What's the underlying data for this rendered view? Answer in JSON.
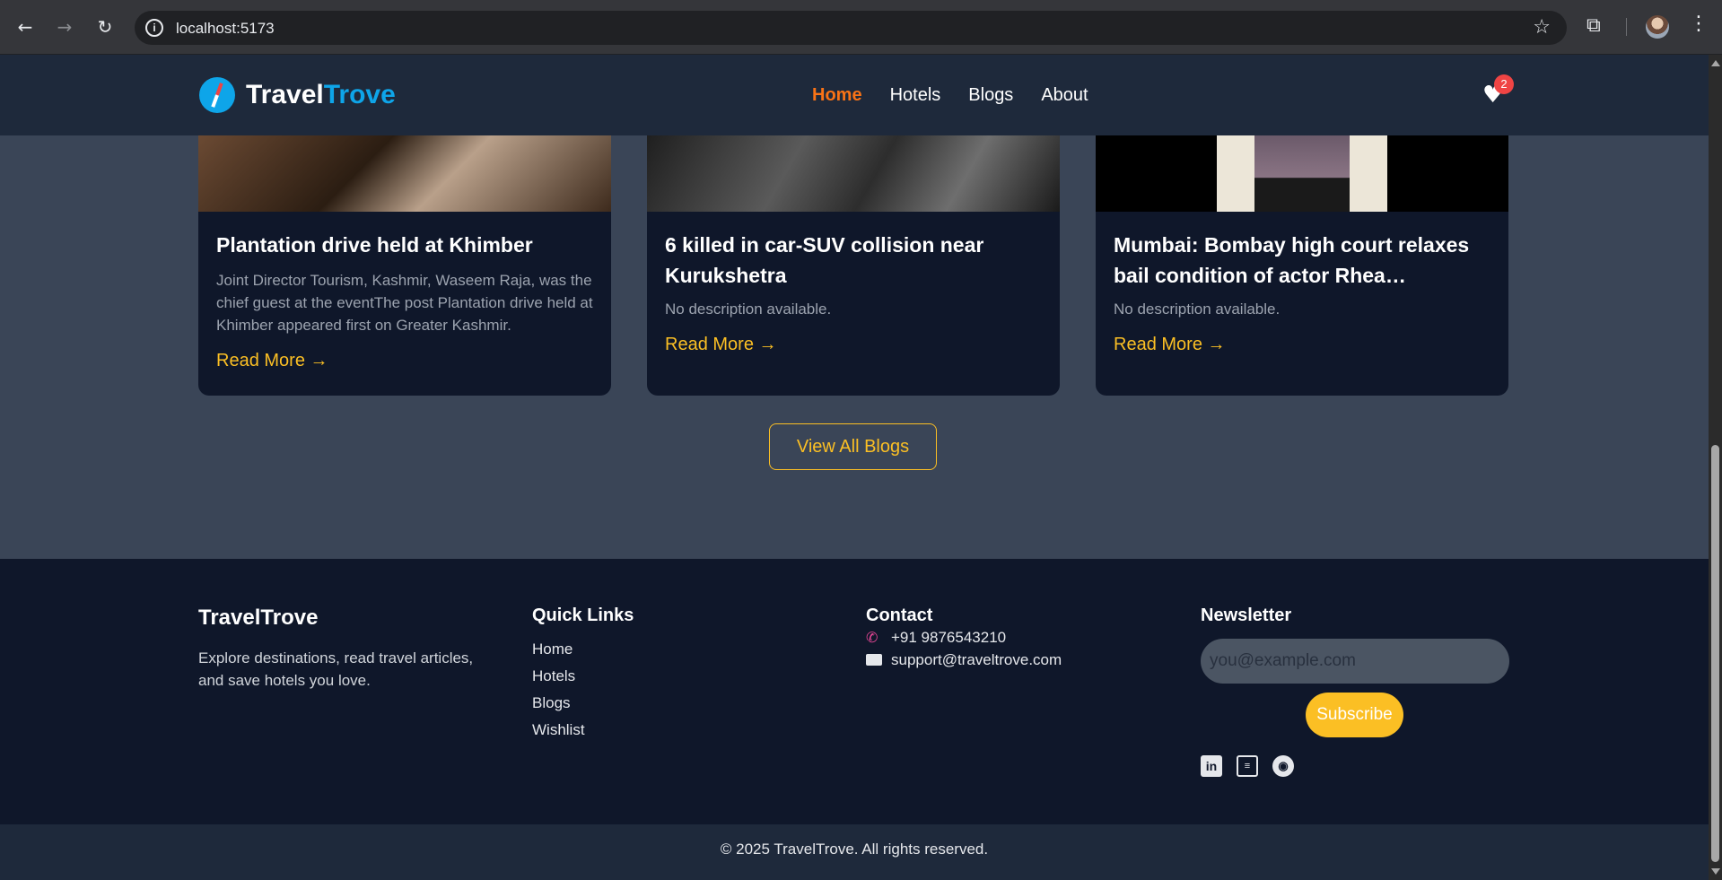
{
  "browser": {
    "url": "localhost:5173"
  },
  "header": {
    "logo_part1": "Travel",
    "logo_part2": "Trove",
    "nav": [
      "Home",
      "Hotels",
      "Blogs",
      "About"
    ],
    "active_nav": "Home",
    "wishlist_count": "2"
  },
  "blogs": [
    {
      "title": "Plantation drive held at Khimber",
      "description": "Joint Director Tourism, Kashmir, Waseem Raja, was the chief guest at the eventThe post Plantation drive held at Khimber appeared first on Greater Kashmir.",
      "link": "Read More →"
    },
    {
      "title": "6 killed in car-SUV collision near Kurukshetra",
      "description": "No description available.",
      "link": "Read More →"
    },
    {
      "title": "Mumbai: Bombay high court relaxes bail condition of actor Rhea…",
      "description": "No description available.",
      "link": "Read More →"
    }
  ],
  "view_all_label": "View All Blogs",
  "footer": {
    "brand": "TravelTrove",
    "tagline": "Explore destinations, read travel articles, and save hotels you love.",
    "quick_links_heading": "Quick Links",
    "quick_links": [
      "Home",
      "Hotels",
      "Blogs",
      "Wishlist"
    ],
    "contact_heading": "Contact",
    "phone": "+91 9876543210",
    "email": "support@traveltrove.com",
    "newsletter_heading": "Newsletter",
    "newsletter_placeholder": "you@example.com",
    "subscribe_label": "Subscribe",
    "social_icons": [
      "linkedin-icon",
      "book-icon",
      "github-icon"
    ],
    "copyright": "© 2025 TravelTrove. All rights reserved."
  },
  "colors": {
    "accent_nav": "#f97316",
    "brand_blue": "#0ea5e9",
    "gold": "#fbbf24",
    "badge_red": "#ef4444"
  }
}
